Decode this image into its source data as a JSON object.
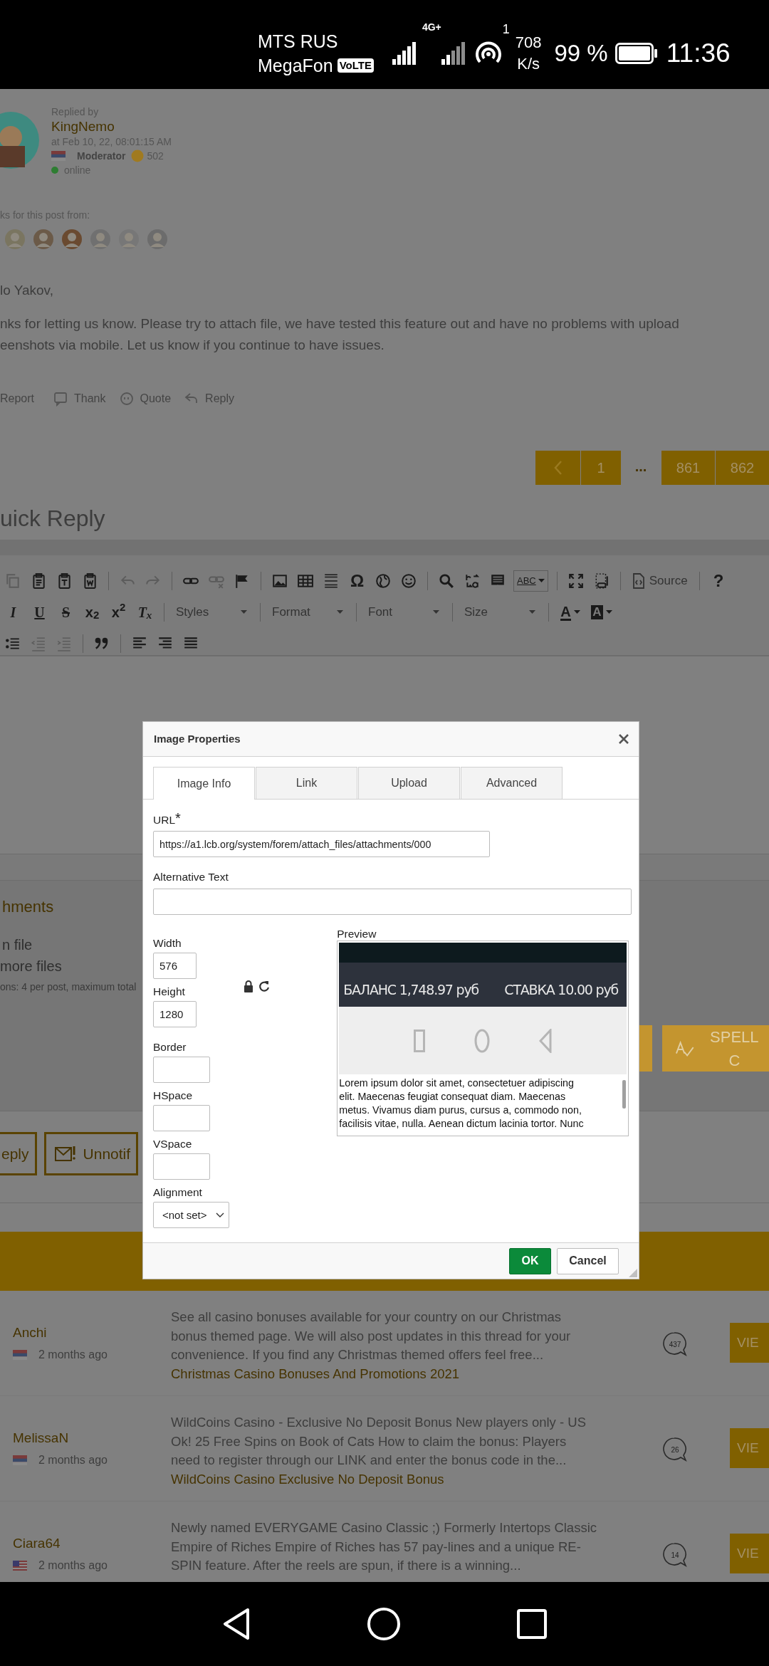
{
  "status_bar": {
    "carrier_1": "MTS RUS",
    "carrier_2": "MegaFon",
    "volte": "VoLTE",
    "network": "4G+",
    "hotspot_count": "1",
    "speed": "708",
    "speed_unit": "K/s",
    "battery": "99 %",
    "time": "11:36"
  },
  "post": {
    "replied_by": "Replied by",
    "author": "KingNemo",
    "date": "at Feb 10, 22, 08:01:15 AM",
    "role": "Moderator",
    "points": "502",
    "status": "online",
    "thanks_label": "ks for this post from:",
    "thanks_avatars": [
      {
        "kind": "picture"
      },
      {
        "kind": "picture"
      },
      {
        "kind": "picture"
      },
      {
        "kind": "picture"
      },
      {
        "kind": "picture"
      },
      {
        "kind": "picture"
      }
    ],
    "greeting": "lo Yakov,",
    "body_lines": [
      "nks for letting us know. Please try to attach file, we have tested this feature out and have no problems with upload",
      "eenshots via mobile. Let us know if you continue to have issues."
    ],
    "actions": [
      {
        "label": "Report"
      },
      {
        "label": "Thank"
      },
      {
        "label": "Quote"
      },
      {
        "label": "Reply"
      }
    ]
  },
  "pagination": [
    {
      "kind": "prev"
    },
    {
      "kind": "page",
      "label": "1"
    },
    {
      "kind": "gap",
      "label": "..."
    },
    {
      "kind": "page",
      "label": "861"
    },
    {
      "kind": "page",
      "label": "862"
    }
  ],
  "quick_reply_title": "uick Reply",
  "toolbar": {
    "row_1": [
      [
        {
          "kind": "icon",
          "disabled": true
        },
        {
          "kind": "icon",
          "disabled": false
        },
        {
          "kind": "icon",
          "disabled": false
        },
        {
          "kind": "icon",
          "disabled": false
        }
      ],
      [
        {
          "kind": "icon",
          "disabled": true
        },
        {
          "kind": "icon",
          "disabled": true
        }
      ],
      [
        {
          "kind": "icon",
          "disabled": false
        },
        {
          "kind": "icon",
          "disabled": true
        },
        {
          "kind": "icon",
          "disabled": false
        }
      ],
      [
        {
          "kind": "icon",
          "disabled": false
        },
        {
          "kind": "icon",
          "disabled": false
        },
        {
          "kind": "icon",
          "disabled": false
        },
        {
          "kind": "glyph",
          "text": "Ω",
          "disabled": false
        },
        {
          "kind": "icon",
          "disabled": false
        },
        {
          "kind": "icon",
          "disabled": false
        }
      ],
      [
        {
          "kind": "icon",
          "disabled": false
        },
        {
          "kind": "icon",
          "disabled": false
        },
        {
          "kind": "icon",
          "disabled": false
        },
        {
          "kind": "spell",
          "text": "ABC",
          "disabled": false
        }
      ],
      [
        {
          "kind": "icon",
          "disabled": false
        },
        {
          "kind": "icon",
          "disabled": false
        }
      ],
      [
        {
          "kind": "button",
          "label": "Source",
          "disabled": false
        }
      ],
      [
        {
          "kind": "glyph",
          "text": "?",
          "disabled": false
        }
      ]
    ],
    "row_2": [
      [
        {
          "kind": "italic",
          "text": "I",
          "disabled": false
        },
        {
          "kind": "underline",
          "text": "U",
          "disabled": false
        },
        {
          "kind": "strike",
          "text": "S",
          "disabled": false
        },
        {
          "kind": "rich",
          "text": "x$_{2}$",
          "disabled": false
        },
        {
          "kind": "rich",
          "text": "x$^{2}$",
          "disabled": false
        },
        {
          "kind": "clear",
          "text": "T$_{x}$",
          "disabled": false
        }
      ],
      [
        {
          "kind": "dropdown",
          "label": "Styles",
          "disabled": false
        }
      ],
      [
        {
          "kind": "dropdown",
          "label": "Format",
          "disabled": false
        }
      ],
      [
        {
          "kind": "dropdown",
          "label": "Font",
          "disabled": false
        }
      ],
      [
        {
          "kind": "dropdown",
          "label": "Size",
          "disabled": false
        }
      ],
      [
        {
          "kind": "color",
          "text": "A",
          "disabled": false
        },
        {
          "kind": "bgcolor",
          "text": "A",
          "disabled": false
        }
      ]
    ],
    "row_3": [
      [
        {
          "kind": "icon",
          "disabled": false
        },
        {
          "kind": "icon",
          "disabled": true
        },
        {
          "kind": "icon",
          "disabled": true
        }
      ],
      [
        {
          "kind": "icon",
          "disabled": false
        }
      ],
      [
        {
          "kind": "icon",
          "disabled": false
        },
        {
          "kind": "icon",
          "disabled": false
        },
        {
          "kind": "icon",
          "disabled": false
        }
      ]
    ]
  },
  "attachments": {
    "title": "hments",
    "choose_file": "n file",
    "more_files": "more files",
    "limits": "ons: 4 per post, maximum total"
  },
  "spell_button": "SPELL C",
  "reply_buttons": [
    {
      "label": "eply"
    },
    {
      "label": "Unnotif"
    }
  ],
  "topics": [
    {
      "author": "Anchi",
      "kind": "serbia",
      "time": "2 months ago",
      "lines": [
        "See all casino bonuses available for your country on our Christmas",
        "bonus themed page. We will also post updates in this thread for your",
        "convenience. If you find any Christmas themed offers feel free..."
      ],
      "link": "Christmas Casino Bonuses And Promotions 2021",
      "replies": "437",
      "view": "VIE"
    },
    {
      "author": "MelissaN",
      "kind": "serbia",
      "time": "2 months ago",
      "lines": [
        "WildCoins Casino - Exclusive No Deposit Bonus New players only - US",
        "Ok! 25 Free Spins on Book of Cats How to claim the bonus: Players",
        "need to register through our LINK and enter the bonus code in the..."
      ],
      "link": "WildCoins Casino Exclusive No Deposit Bonus",
      "replies": "26",
      "view": "VIE"
    },
    {
      "author": "Ciara64",
      "kind": "usa",
      "time": "2 months ago",
      "lines": [
        "Newly named EVERYGAME Casino Classic ;) Formerly Intertops Classic",
        "Empire of Riches Empire of Riches has 57 pay-lines and a unique RE-",
        "SPIN feature. After the reels are spun, if there is a winning..."
      ],
      "replies": "14",
      "view": "VIE"
    }
  ],
  "dialog": {
    "title": "Image Properties",
    "tabs": [
      {
        "label": "Image Info",
        "selected": true
      },
      {
        "label": "Link",
        "selected": false
      },
      {
        "label": "Upload",
        "selected": false
      },
      {
        "label": "Advanced",
        "selected": false
      }
    ],
    "url": {
      "label": "URL",
      "required_mark": "*",
      "value": "https://a1.lcb.org/system/forem/attach_files/attachments/000"
    },
    "alt_text": {
      "label": "Alternative Text"
    },
    "width": {
      "label": "Width",
      "value": "576"
    },
    "height": {
      "label": "Height",
      "value": "1280"
    },
    "border": {
      "label": "Border"
    },
    "hspace": {
      "label": "HSpace"
    },
    "vspace": {
      "label": "VSpace"
    },
    "alignment": {
      "label": "Alignment",
      "value": "<not set>"
    },
    "preview": {
      "label": "Preview",
      "balance": "БАЛАНС 1,748.97 руб",
      "stake": "СТАВКА 10.00 руб",
      "lines": [
        "Lorem ipsum dolor sit amet, consectetuer adipiscing",
        "elit. Maecenas feugiat consequat diam. Maecenas",
        "metus. Vivamus diam purus, cursus a, commodo non,",
        "facilisis vitae, nulla. Aenean dictum lacinia tortor. Nunc"
      ]
    },
    "buttons": [
      {
        "label": "OK",
        "kind": "primary"
      },
      {
        "label": "Cancel",
        "kind": "secondary"
      }
    ]
  }
}
